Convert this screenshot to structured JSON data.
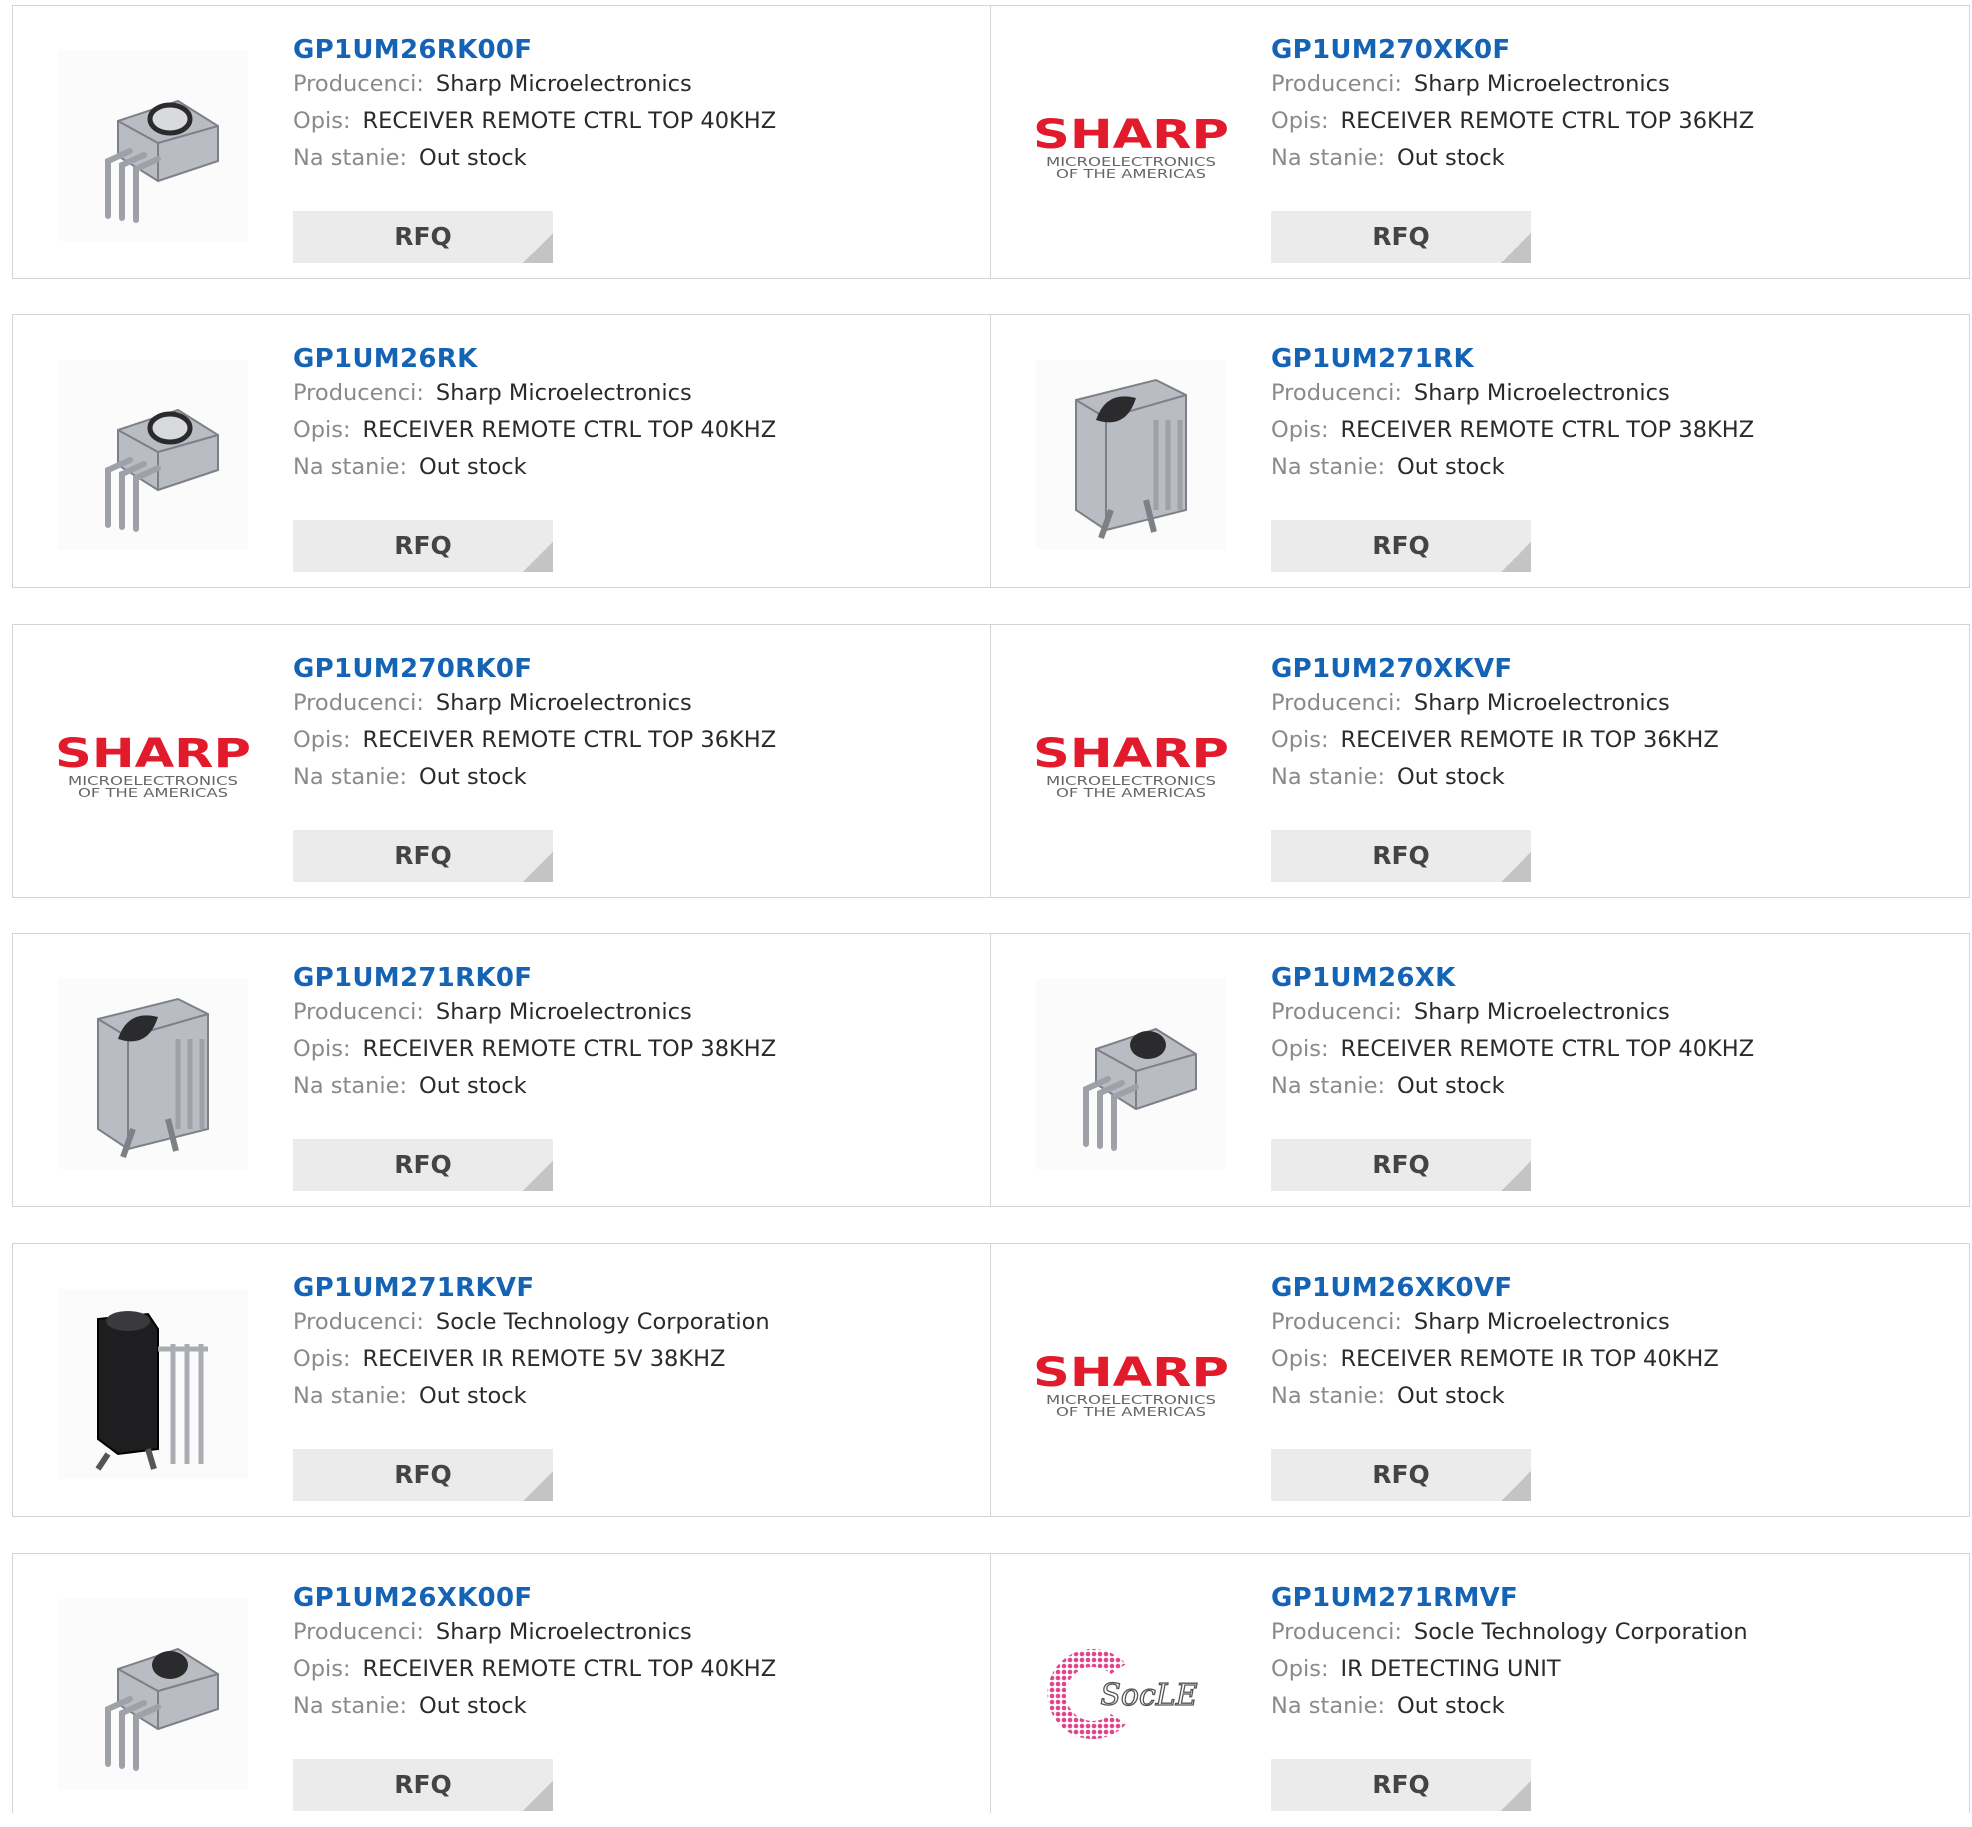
{
  "labels": {
    "manufacturer": "Producenci:",
    "description": "Opis:",
    "stock": "Na stanie:",
    "rfq": "RFQ"
  },
  "colors": {
    "part_link": "#1563b4",
    "sharp_red": "#e11b2c",
    "socle_pink": "#e0448c",
    "rfq_bg": "#ebebeb"
  },
  "logo_text": {
    "sharp_main": "SHARP",
    "sharp_sub1": "MICROELECTRONICS",
    "sharp_sub2": "OF THE AMERICAS",
    "socle": "SocLE"
  },
  "rows": [
    {
      "left": {
        "part": "GP1UM26RK00F",
        "manufacturer": "Sharp Microelectronics",
        "description": "RECEIVER REMOTE CTRL TOP 40KHZ",
        "stock": "Out stock",
        "image": "sensor-small-icon"
      },
      "right": {
        "part": "GP1UM270XK0F",
        "manufacturer": "Sharp Microelectronics",
        "description": "RECEIVER REMOTE CTRL TOP 36KHZ",
        "stock": "Out stock",
        "image": "sharp-logo"
      }
    },
    {
      "left": {
        "part": "GP1UM26RK",
        "manufacturer": "Sharp Microelectronics",
        "description": "RECEIVER REMOTE CTRL TOP 40KHZ",
        "stock": "Out stock",
        "image": "sensor-small-icon"
      },
      "right": {
        "part": "GP1UM271RK",
        "manufacturer": "Sharp Microelectronics",
        "description": "RECEIVER REMOTE CTRL TOP 38KHZ",
        "stock": "Out stock",
        "image": "sensor-tall-icon"
      }
    },
    {
      "left": {
        "part": "GP1UM270RK0F",
        "manufacturer": "Sharp Microelectronics",
        "description": "RECEIVER REMOTE CTRL TOP 36KHZ",
        "stock": "Out stock",
        "image": "sharp-logo"
      },
      "right": {
        "part": "GP1UM270XKVF",
        "manufacturer": "Sharp Microelectronics",
        "description": "RECEIVER REMOTE IR TOP 36KHZ",
        "stock": "Out stock",
        "image": "sharp-logo"
      }
    },
    {
      "left": {
        "part": "GP1UM271RK0F",
        "manufacturer": "Sharp Microelectronics",
        "description": "RECEIVER REMOTE CTRL TOP 38KHZ",
        "stock": "Out stock",
        "image": "sensor-tall-icon"
      },
      "right": {
        "part": "GP1UM26XK",
        "manufacturer": "Sharp Microelectronics",
        "description": "RECEIVER REMOTE CTRL TOP 40KHZ",
        "stock": "Out stock",
        "image": "sensor-dome-icon"
      }
    },
    {
      "left": {
        "part": "GP1UM271RKVF",
        "manufacturer": "Socle Technology Corporation",
        "description": "RECEIVER IR REMOTE 5V 38KHZ",
        "stock": "Out stock",
        "image": "sensor-black-icon"
      },
      "right": {
        "part": "GP1UM26XK0VF",
        "manufacturer": "Sharp Microelectronics",
        "description": "RECEIVER REMOTE IR TOP 40KHZ",
        "stock": "Out stock",
        "image": "sharp-logo"
      }
    },
    {
      "left": {
        "part": "GP1UM26XK00F",
        "manufacturer": "Sharp Microelectronics",
        "description": "RECEIVER REMOTE CTRL TOP 40KHZ",
        "stock": "Out stock",
        "image": "sensor-dome-icon"
      },
      "right": {
        "part": "GP1UM271RMVF",
        "manufacturer": "Socle Technology Corporation",
        "description": "IR DETECTING UNIT",
        "stock": "Out stock",
        "image": "socle-logo"
      }
    }
  ]
}
